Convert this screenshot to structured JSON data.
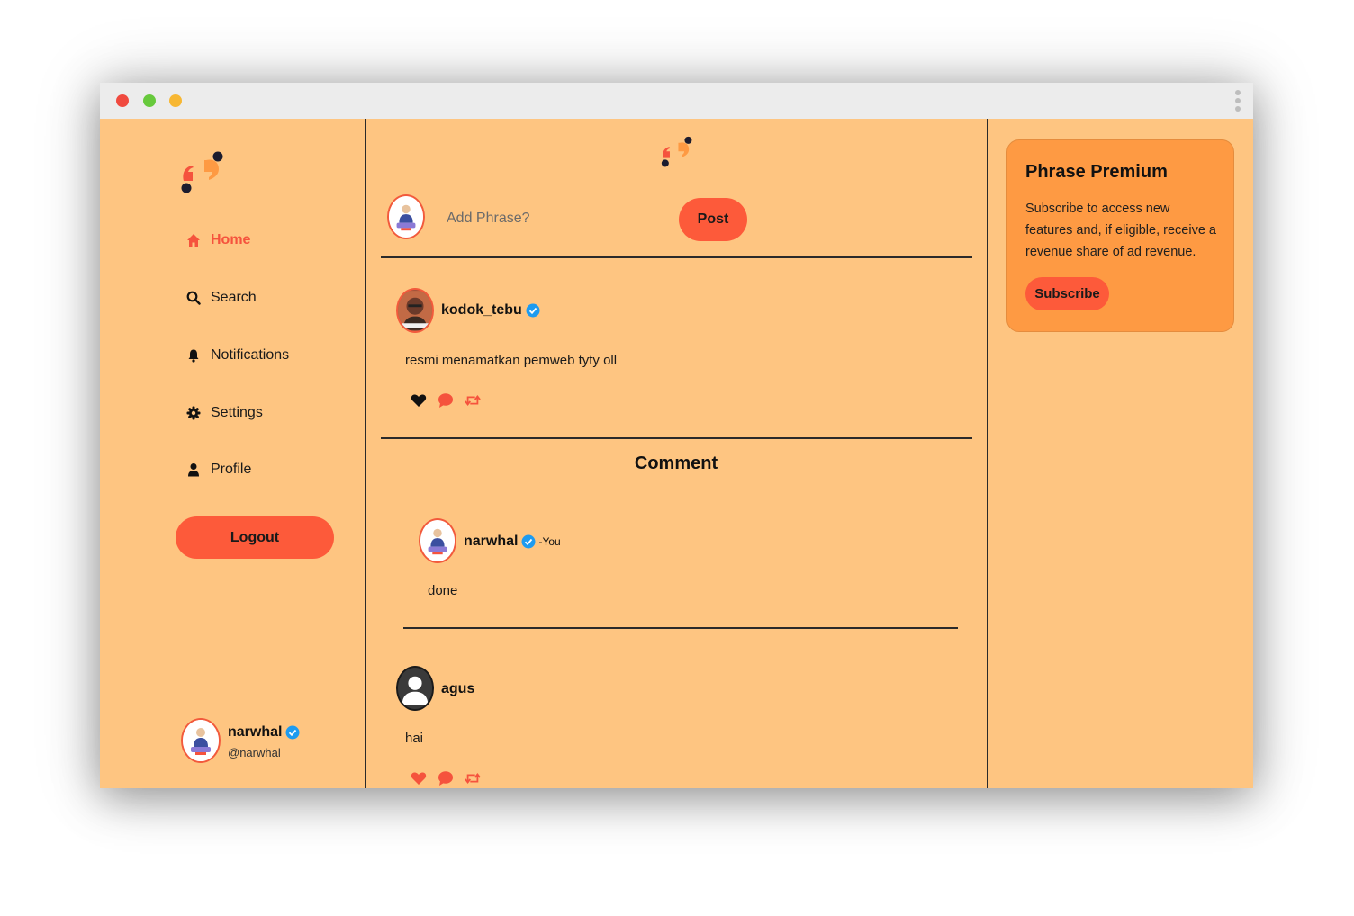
{
  "colors": {
    "background": "#fec581",
    "accent": "#fd5a3a",
    "premium_card": "#fe9a43",
    "verified": "#1d9bf0"
  },
  "sidebar": {
    "logo_icon": "phrase-quote-logo",
    "nav": [
      {
        "label": "Home",
        "icon": "home-icon",
        "active": true
      },
      {
        "label": "Search",
        "icon": "search-icon"
      },
      {
        "label": "Notifications",
        "icon": "bell-icon"
      },
      {
        "label": "Settings",
        "icon": "gear-icon"
      },
      {
        "label": "Profile",
        "icon": "user-icon"
      }
    ],
    "logout_label": "Logout",
    "current_user": {
      "name": "narwhal",
      "handle": "@narwhal"
    }
  },
  "compose": {
    "placeholder": "Add Phrase?",
    "post_label": "Post"
  },
  "post": {
    "author": "kodok_tebu",
    "text": "resmi menamatkan pemweb tyty oll"
  },
  "comments": {
    "title": "Comment",
    "items": [
      {
        "author": "narwhal",
        "you_tag": "-You",
        "text": "done"
      },
      {
        "author": "agus",
        "text": "hai"
      }
    ]
  },
  "premium": {
    "title": "Phrase Premium",
    "body": "Subscribe to access new features and, if eligible, receive a revenue share of ad revenue.",
    "button": "Subscribe"
  }
}
